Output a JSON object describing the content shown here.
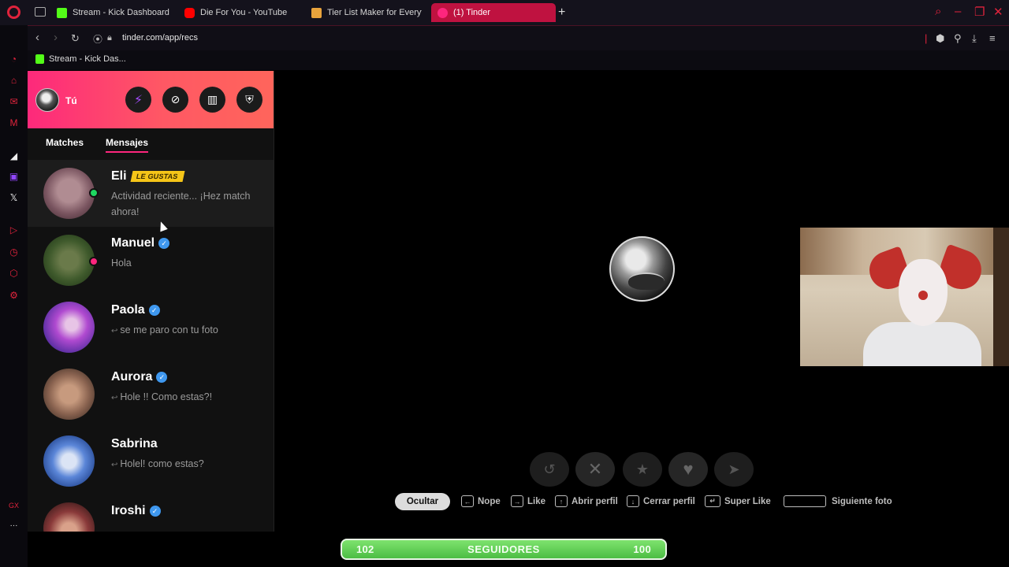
{
  "browser": {
    "tabs": [
      {
        "title": "Stream - Kick Dashboard",
        "favicon": "kick-icon",
        "color": "#53fc18"
      },
      {
        "title": "Die For You - YouTube",
        "favicon": "youtube-icon",
        "color": "#ff0000"
      },
      {
        "title": "Tier List Maker for Everyt",
        "favicon": "tierlist-icon",
        "color": "#e8a33c"
      },
      {
        "title": "(1) Tinder",
        "favicon": "tinder-icon",
        "color": "#fd267d"
      }
    ],
    "url": "tinder.com/app/recs",
    "bookmark": "Stream - Kick Das..."
  },
  "tinder": {
    "me_label": "Tú",
    "tabs": [
      "Matches",
      "Mensajes"
    ],
    "active_tab": "Mensajes",
    "messages": [
      {
        "name": "Eli",
        "badge": "LE GUSTAS",
        "preview": "Actividad reciente... ¡Hez match ahora!",
        "status_color": "#1ed760",
        "reply": false
      },
      {
        "name": "Manuel",
        "verified": true,
        "preview": "Hola",
        "status_color": "#fd267d",
        "reply": false
      },
      {
        "name": "Paola",
        "verified": true,
        "preview": "se me paro con tu foto",
        "reply": true
      },
      {
        "name": "Aurora",
        "verified": true,
        "preview": "Hole !! Como estas?!",
        "reply": true
      },
      {
        "name": "Sabrina",
        "verified": false,
        "preview": "Holel! como estas?",
        "reply": true
      },
      {
        "name": "Iroshi",
        "verified": true,
        "preview": "",
        "reply": false
      }
    ]
  },
  "shortcuts": {
    "hide": "Ocultar",
    "nope": "Nope",
    "like": "Like",
    "open_profile": "Abrir perfil",
    "close_profile": "Cerrar perfil",
    "super_like": "Super Like",
    "next_photo": "Siguiente foto"
  },
  "followers_bar": {
    "left": "102",
    "label": "SEGUIDORES",
    "right": "100"
  }
}
